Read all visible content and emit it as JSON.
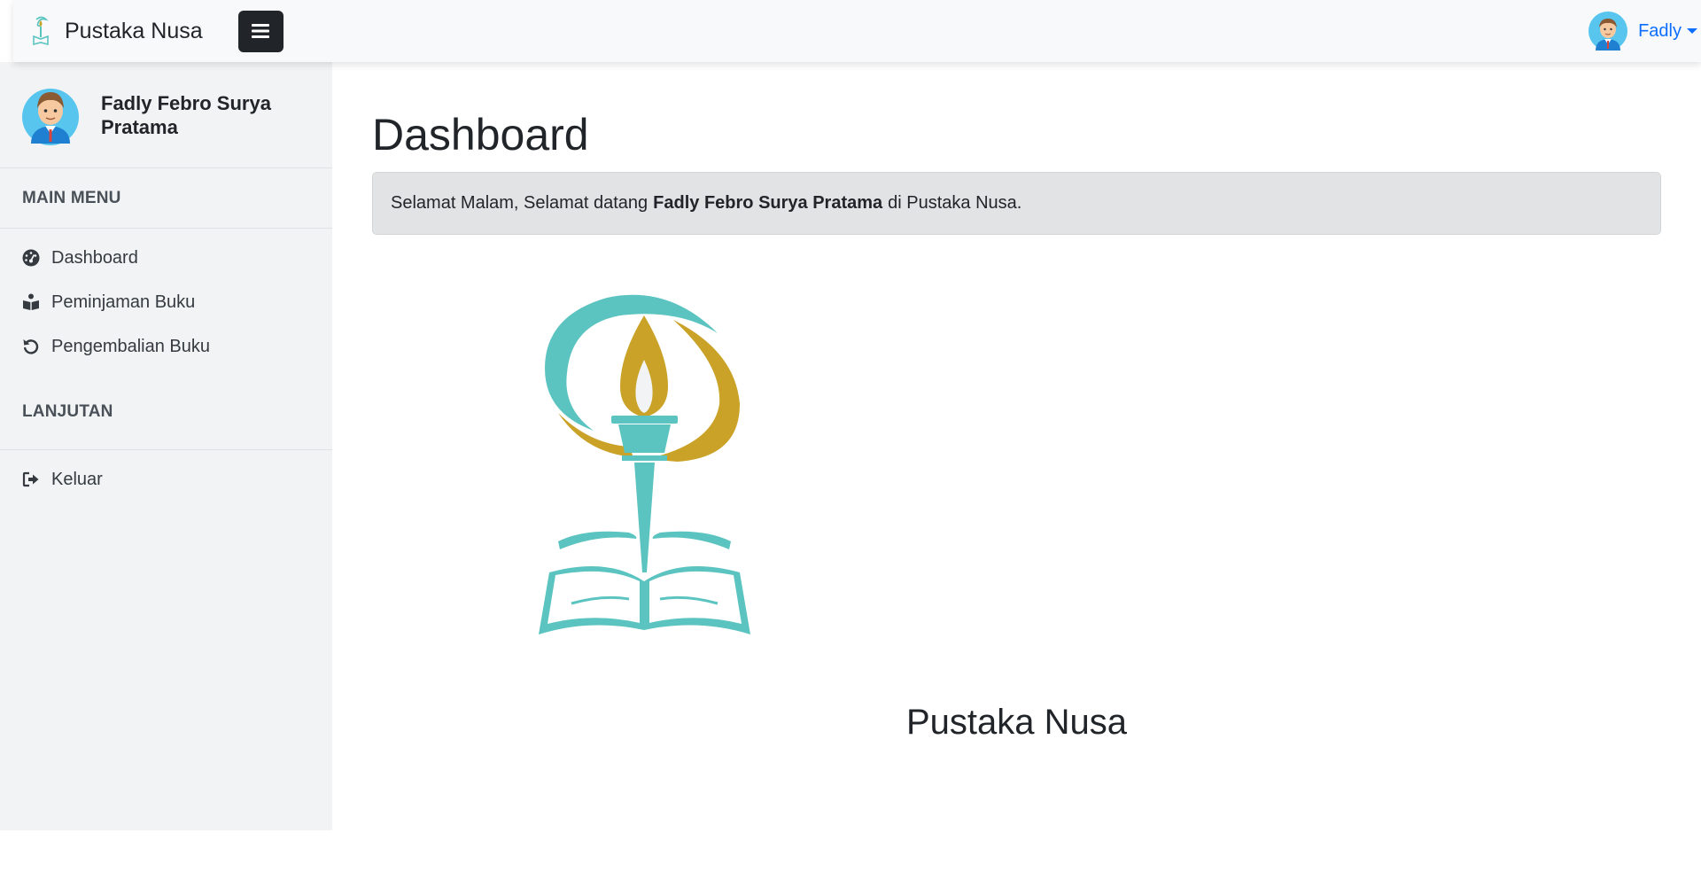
{
  "app": {
    "brand_name": "Pustaka Nusa"
  },
  "navbar": {
    "user_short_name": "Fadly"
  },
  "sidebar": {
    "profile_name": "Fadly Febro Surya Pratama",
    "main_menu_heading": "MAIN MENU",
    "main_menu_items": [
      {
        "label": "Dashboard",
        "icon": "dashboard-gauge-icon"
      },
      {
        "label": "Peminjaman Buku",
        "icon": "book-reader-icon"
      },
      {
        "label": "Pengembalian Buku",
        "icon": "undo-icon"
      }
    ],
    "advanced_heading": "LANJUTAN",
    "advanced_items": [
      {
        "label": "Keluar",
        "icon": "sign-out-icon"
      }
    ]
  },
  "main": {
    "page_title": "Dashboard",
    "greeting_prefix": "Selamat Malam, Selamat datang",
    "greeting_name": "Fadly Febro Surya Pratama",
    "greeting_suffix": "di Pustaka Nusa.",
    "logo_caption": "Pustaka Nusa"
  },
  "colors": {
    "accent": "#0d6efd",
    "logo_teal": "#5cc4c0",
    "logo_gold": "#c9a227",
    "sidebar_bg": "#f1f3f5",
    "alert_bg": "#e2e3e5"
  }
}
